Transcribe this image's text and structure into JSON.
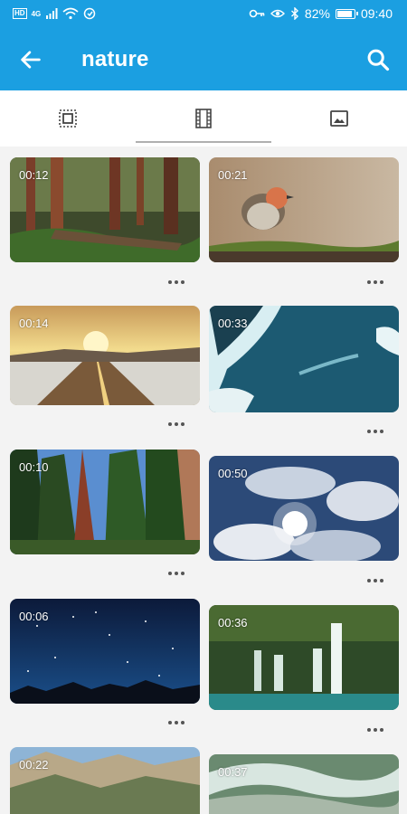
{
  "status_bar": {
    "battery": "82%",
    "time": "09:40",
    "hd_label": "HD",
    "signal": "4G"
  },
  "app_bar": {
    "title": "nature"
  },
  "tabs": [
    {
      "name": "albums",
      "icon": "album-frame-icon"
    },
    {
      "name": "videos",
      "icon": "film-icon",
      "selected": true
    },
    {
      "name": "photos",
      "icon": "image-icon"
    }
  ],
  "videos": [
    {
      "duration": "00:12"
    },
    {
      "duration": "00:21"
    },
    {
      "duration": "00:14"
    },
    {
      "duration": "00:33"
    },
    {
      "duration": "00:10"
    },
    {
      "duration": "00:50"
    },
    {
      "duration": "00:06"
    },
    {
      "duration": "00:36"
    },
    {
      "duration": "00:22"
    },
    {
      "duration": "00:37"
    }
  ],
  "colors": {
    "accent": "#1b9fe1"
  }
}
